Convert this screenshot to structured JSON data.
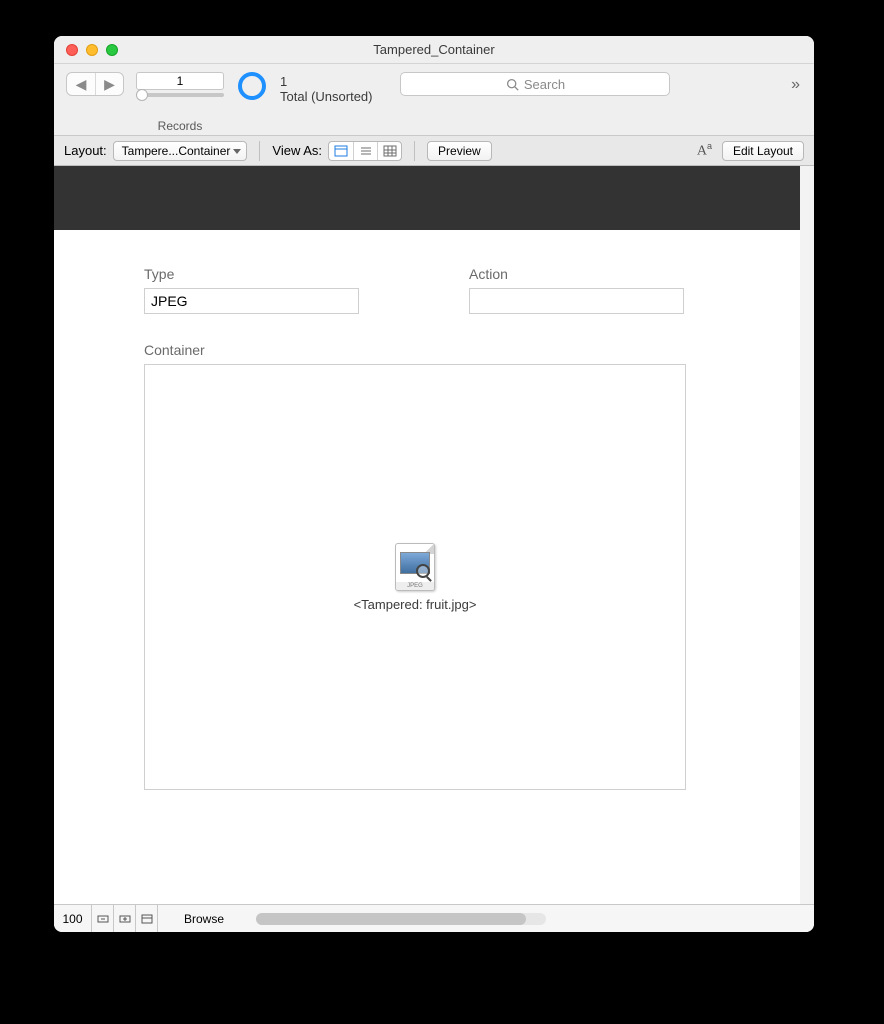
{
  "window": {
    "title": "Tampered_Container"
  },
  "toolbar": {
    "record_number": "1",
    "records_label": "Records",
    "total_count": "1",
    "total_label": "Total (Unsorted)",
    "search_placeholder": "Search"
  },
  "layoutbar": {
    "layout_label": "Layout:",
    "layout_selected": "Tampere...Container",
    "view_as_label": "View As:",
    "preview_label": "Preview",
    "edit_layout_label": "Edit Layout"
  },
  "form": {
    "type_label": "Type",
    "type_value": "JPEG",
    "action_label": "Action",
    "action_value": "",
    "container_label": "Container",
    "file_badge": "JPEG",
    "tampered_text": "<Tampered: fruit.jpg>"
  },
  "statusbar": {
    "zoom": "100",
    "mode": "Browse"
  }
}
